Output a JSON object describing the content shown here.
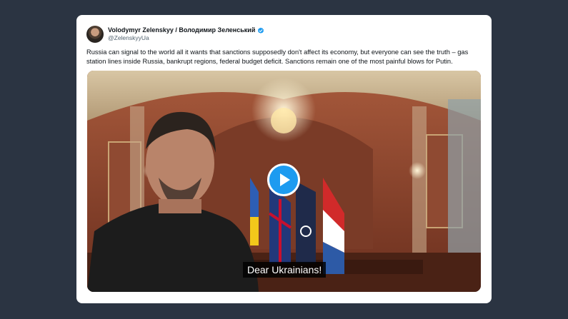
{
  "tweet": {
    "author": {
      "display_name": "Volodymyr Zelenskyy / Володимир Зеленський",
      "handle": "@ZelenskyyUa",
      "verified_icon": "verified-badge-icon"
    },
    "text": "Russia can signal to the world all it wants that sanctions supposedly don't affect its economy, but everyone can see the truth – gas station lines inside Russia, bankrupt regions, federal budget deficit. Sanctions remain one of the most painful blows for Putin.",
    "media": {
      "type": "video",
      "play_icon": "play-icon",
      "caption": "Dear Ukrainians!"
    }
  },
  "colors": {
    "background": "#2b3442",
    "card": "#ffffff",
    "accent": "#1d9bf0",
    "text": "#0f1419",
    "muted": "#536471"
  }
}
